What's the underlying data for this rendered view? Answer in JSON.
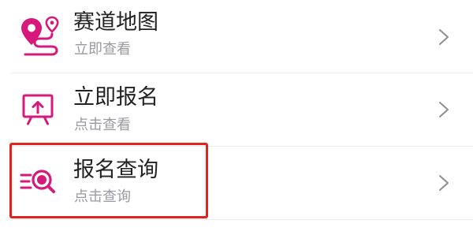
{
  "accent_color": "#d6197a",
  "highlight_color": "#e3221c",
  "menu": {
    "items": [
      {
        "title": "赛道地图",
        "subtitle": "立即查看",
        "icon": "route-map-icon"
      },
      {
        "title": "立即报名",
        "subtitle": "点击查看",
        "icon": "register-board-icon"
      },
      {
        "title": "报名查询",
        "subtitle": "点击查询",
        "icon": "search-list-icon"
      }
    ]
  }
}
